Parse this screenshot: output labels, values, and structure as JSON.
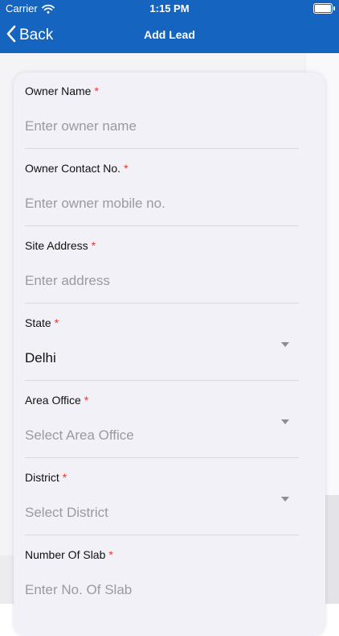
{
  "status_bar": {
    "carrier": "Carrier",
    "time": "1:15 PM"
  },
  "nav": {
    "back_label": "Back",
    "title": "Add Lead"
  },
  "form": {
    "owner_name": {
      "label": "Owner Name",
      "required": "*",
      "placeholder": "Enter owner name"
    },
    "owner_contact": {
      "label": "Owner Contact No.",
      "required": "*",
      "placeholder": "Enter owner mobile no."
    },
    "site_address": {
      "label": "Site Address",
      "required": "*",
      "placeholder": "Enter address"
    },
    "state": {
      "label": "State",
      "required": "*",
      "value": "Delhi"
    },
    "area_office": {
      "label": "Area Office",
      "required": "*",
      "placeholder": "Select Area Office"
    },
    "district": {
      "label": "District",
      "required": "*",
      "placeholder": "Select District"
    },
    "number_of_slab": {
      "label": "Number Of Slab",
      "required": "*",
      "placeholder": "Enter No. Of Slab"
    }
  },
  "colors": {
    "header": "#1565c0",
    "required": "#e53935",
    "card": "#f2f1f7"
  },
  "icons": {
    "back": "chevron-left-icon",
    "dropdown": "caret-down-icon",
    "wifi": "wifi-icon",
    "battery": "battery-icon"
  }
}
